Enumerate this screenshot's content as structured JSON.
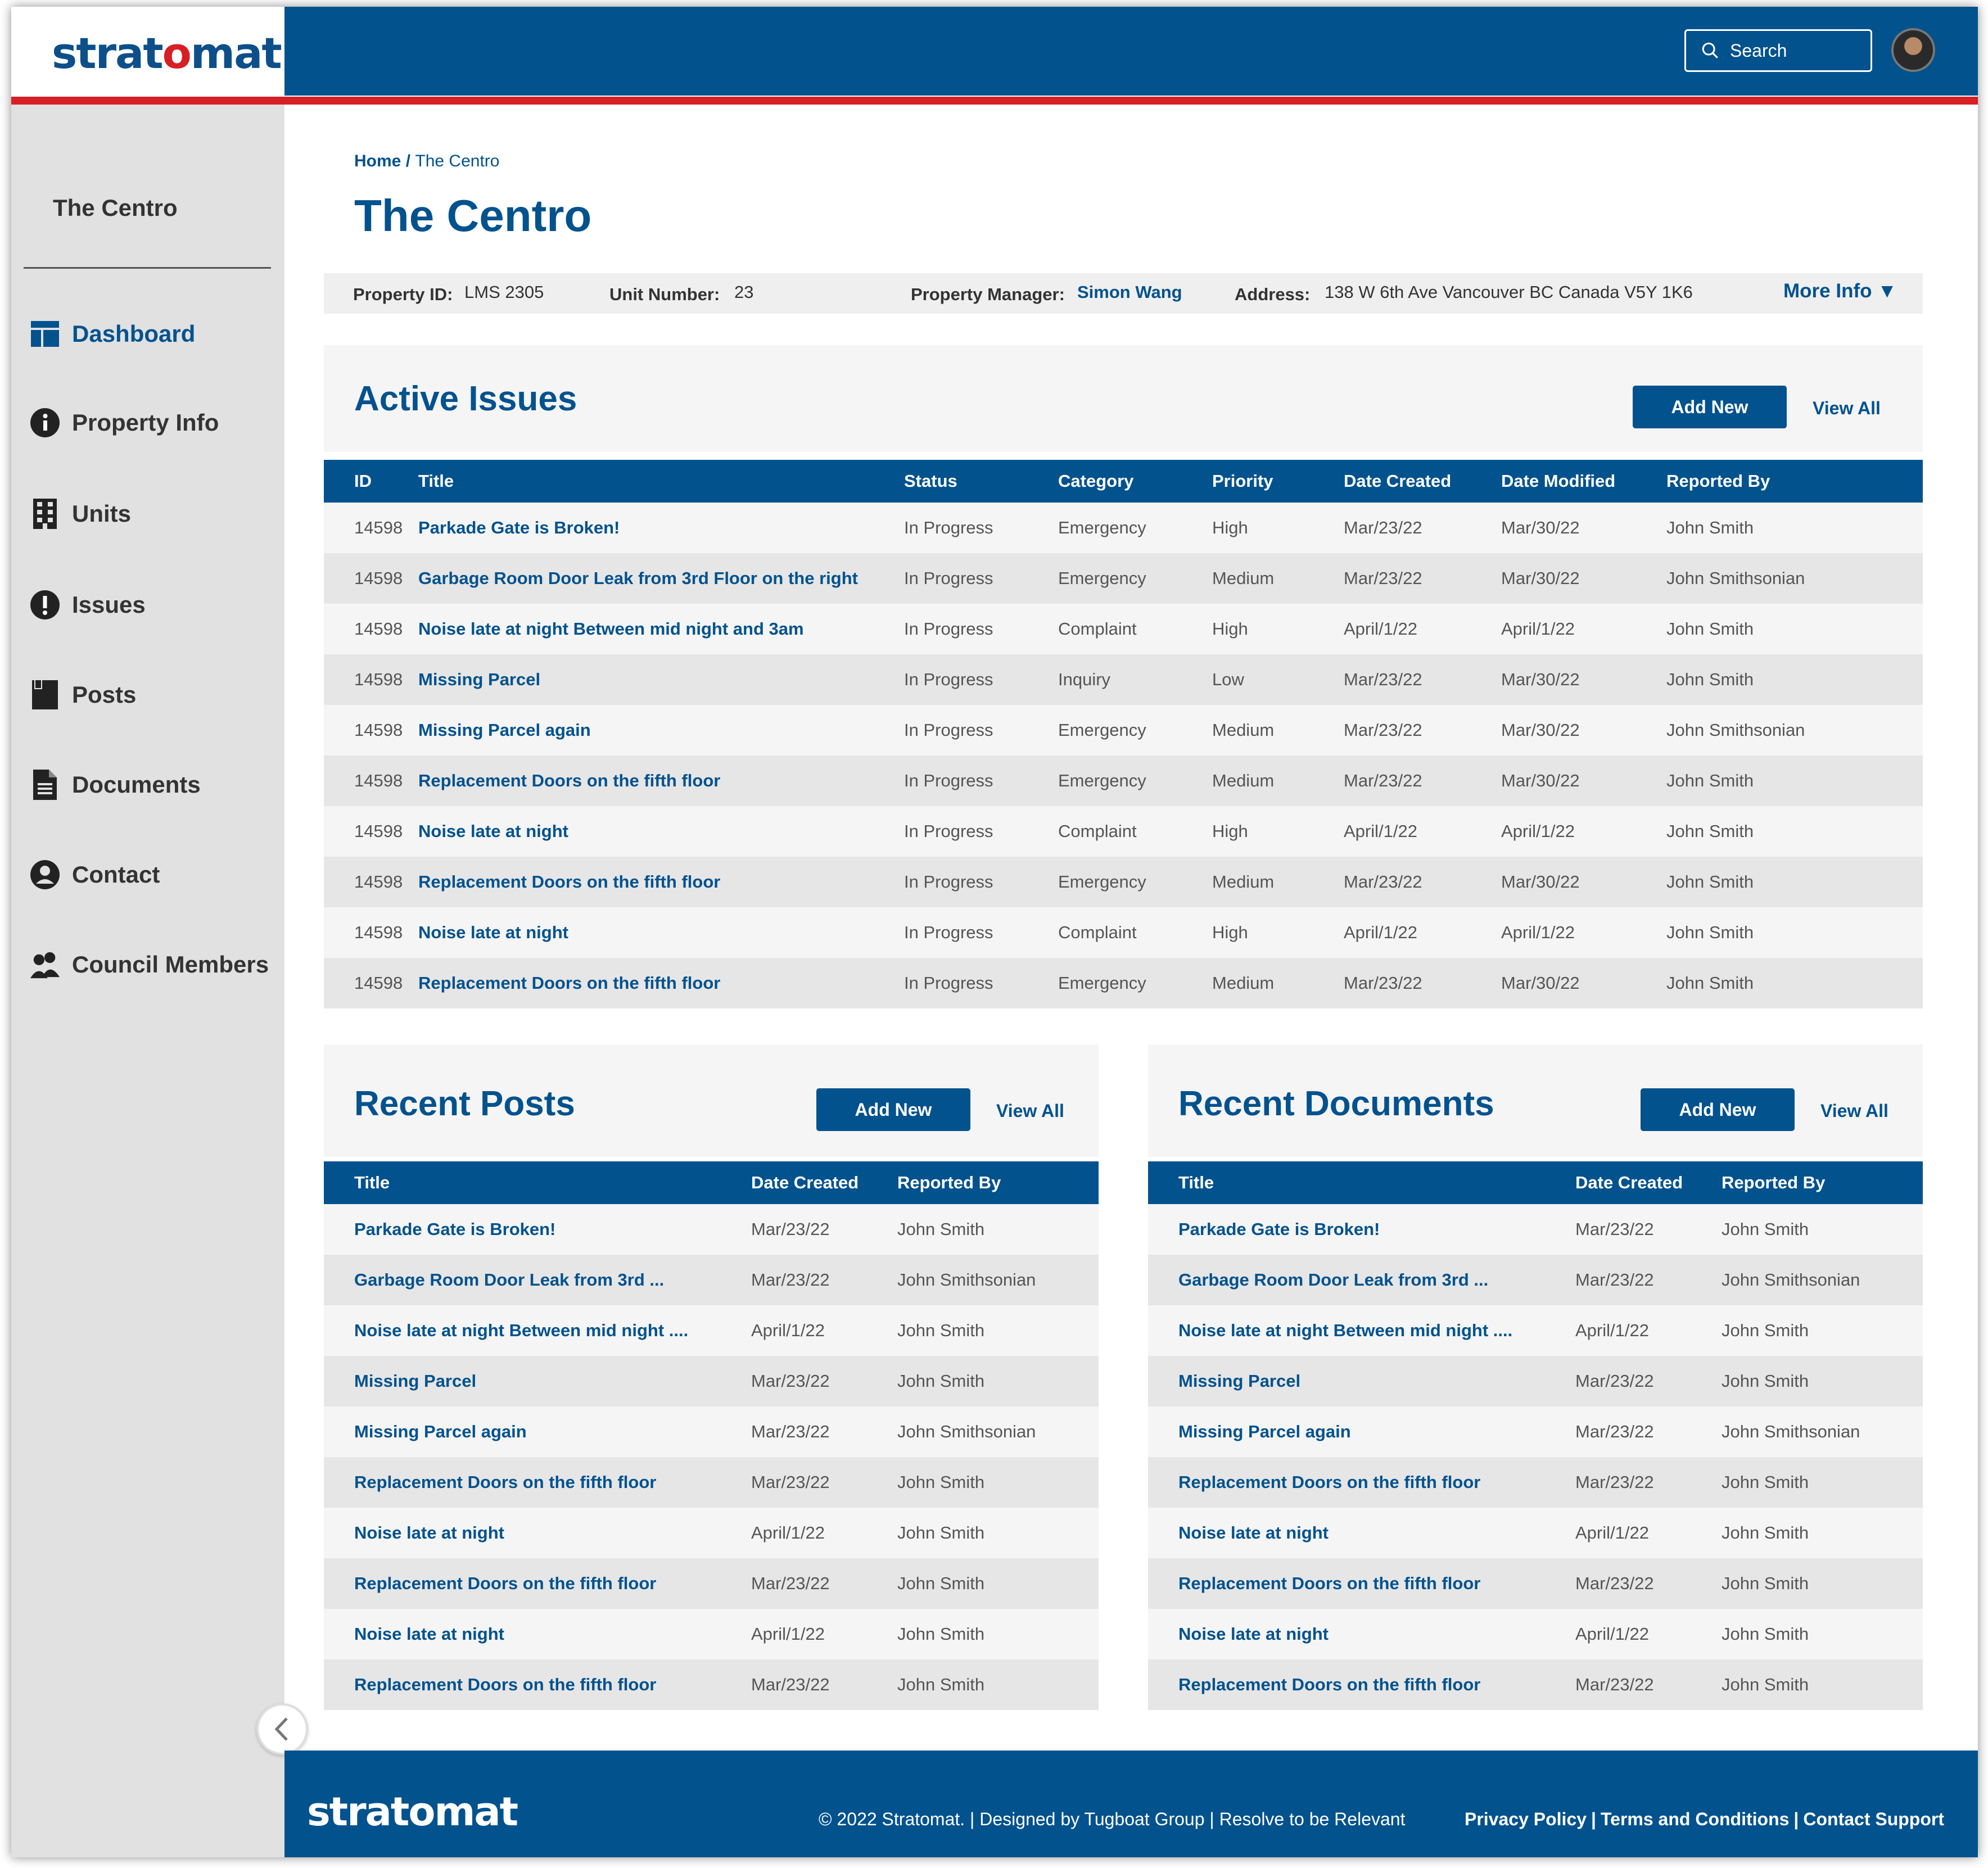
{
  "brand": {
    "name_pre": "strat",
    "name_o": "o",
    "name_post": "mat",
    "footer_name": "stratomat"
  },
  "header": {
    "search_placeholder": "Search"
  },
  "sidebar": {
    "property": "The Centro",
    "items": [
      {
        "label": "Dashboard",
        "icon": "dashboard-icon"
      },
      {
        "label": "Property Info",
        "icon": "info-icon"
      },
      {
        "label": "Units",
        "icon": "building-icon"
      },
      {
        "label": "Issues",
        "icon": "alert-icon"
      },
      {
        "label": "Posts",
        "icon": "posts-icon"
      },
      {
        "label": "Documents",
        "icon": "document-icon"
      },
      {
        "label": "Contact",
        "icon": "user-circle-icon"
      },
      {
        "label": "Council Members",
        "icon": "people-icon"
      }
    ]
  },
  "breadcrumb": {
    "home": "Home",
    "sep": " / ",
    "current": "The Centro"
  },
  "page_title": "The Centro",
  "info": {
    "property_id_label": "Property ID:",
    "property_id": "LMS 2305",
    "unit_label": "Unit Number:",
    "unit": "23",
    "manager_label": "Property Manager:",
    "manager": "Simon Wang",
    "address_label": "Address:",
    "address": "138 W 6th Ave Vancouver BC Canada  V5Y 1K6",
    "more": "More Info ▼"
  },
  "issues": {
    "title": "Active Issues",
    "add": "Add New",
    "view_all": "View All",
    "headers": [
      "ID",
      "Title",
      "Status",
      "Category",
      "Priority",
      "Date Created",
      "Date Modified",
      "Reported By"
    ],
    "rows": [
      [
        "14598",
        "Parkade Gate is Broken!",
        "In Progress",
        "Emergency",
        "High",
        "Mar/23/22",
        "Mar/30/22",
        "John Smith"
      ],
      [
        "14598",
        "Garbage Room Door Leak from 3rd Floor on the right",
        "In Progress",
        "Emergency",
        "Medium",
        "Mar/23/22",
        "Mar/30/22",
        "John Smithsonian"
      ],
      [
        "14598",
        "Noise late at night Between mid night and 3am",
        "In Progress",
        "Complaint",
        "High",
        "April/1/22",
        "April/1/22",
        "John Smith"
      ],
      [
        "14598",
        "Missing Parcel",
        "In Progress",
        "Inquiry",
        "Low",
        "Mar/23/22",
        "Mar/30/22",
        "John Smith"
      ],
      [
        "14598",
        "Missing Parcel again",
        "In Progress",
        "Emergency",
        "Medium",
        "Mar/23/22",
        "Mar/30/22",
        "John Smithsonian"
      ],
      [
        "14598",
        "Replacement Doors on the fifth floor",
        "In Progress",
        "Emergency",
        "Medium",
        "Mar/23/22",
        "Mar/30/22",
        "John Smith"
      ],
      [
        "14598",
        "Noise late at night",
        "In Progress",
        "Complaint",
        "High",
        "April/1/22",
        "April/1/22",
        "John Smith"
      ],
      [
        "14598",
        "Replacement Doors on the fifth floor",
        "In Progress",
        "Emergency",
        "Medium",
        "Mar/23/22",
        "Mar/30/22",
        "John Smith"
      ],
      [
        "14598",
        "Noise late at night",
        "In Progress",
        "Complaint",
        "High",
        "April/1/22",
        "April/1/22",
        "John Smith"
      ],
      [
        "14598",
        "Replacement Doors on the fifth floor",
        "In Progress",
        "Emergency",
        "Medium",
        "Mar/23/22",
        "Mar/30/22",
        "John Smith"
      ]
    ]
  },
  "posts": {
    "title": "Recent Posts",
    "add": "Add New",
    "view_all": "View All",
    "headers": [
      "Title",
      "Date Created",
      "Reported By"
    ],
    "rows": [
      [
        "Parkade Gate is Broken!",
        "Mar/23/22",
        "John Smith"
      ],
      [
        "Garbage Room Door Leak from 3rd ...",
        "Mar/23/22",
        "John Smithsonian"
      ],
      [
        "Noise late at night Between mid night ....",
        "April/1/22",
        "John Smith"
      ],
      [
        "Missing Parcel",
        "Mar/23/22",
        "John Smith"
      ],
      [
        "Missing Parcel again",
        "Mar/23/22",
        "John Smithsonian"
      ],
      [
        "Replacement Doors on the fifth floor",
        "Mar/23/22",
        "John Smith"
      ],
      [
        "Noise late at night",
        "April/1/22",
        "John Smith"
      ],
      [
        "Replacement Doors on the fifth floor",
        "Mar/23/22",
        "John Smith"
      ],
      [
        "Noise late at night",
        "April/1/22",
        "John Smith"
      ],
      [
        "Replacement Doors on the fifth floor",
        "Mar/23/22",
        "John Smith"
      ]
    ]
  },
  "documents": {
    "title": "Recent Documents",
    "add": "Add New",
    "view_all": "View All",
    "headers": [
      "Title",
      "Date Created",
      "Reported By"
    ],
    "rows": [
      [
        "Parkade Gate is Broken!",
        "Mar/23/22",
        "John Smith"
      ],
      [
        "Garbage Room Door Leak from 3rd ...",
        "Mar/23/22",
        "John Smithsonian"
      ],
      [
        "Noise late at night Between mid night ....",
        "April/1/22",
        "John Smith"
      ],
      [
        "Missing Parcel",
        "Mar/23/22",
        "John Smith"
      ],
      [
        "Missing Parcel again",
        "Mar/23/22",
        "John Smithsonian"
      ],
      [
        "Replacement Doors on the fifth floor",
        "Mar/23/22",
        "John Smith"
      ],
      [
        "Noise late at night",
        "April/1/22",
        "John Smith"
      ],
      [
        "Replacement Doors on the fifth floor",
        "Mar/23/22",
        "John Smith"
      ],
      [
        "Noise late at night",
        "April/1/22",
        "John Smith"
      ],
      [
        "Replacement Doors on the fifth floor",
        "Mar/23/22",
        "John Smith"
      ]
    ]
  },
  "footer": {
    "copyright": "© 2022 Stratomat. | Designed by Tugboat Group |  Resolve to be Relevant",
    "links": [
      "Privacy Policy",
      "|",
      "Terms and Conditions",
      "|",
      "Contact Support"
    ]
  },
  "colors": {
    "primary": "#02528e",
    "accent": "#d71f26",
    "sidebar": "#e1e1e1"
  }
}
